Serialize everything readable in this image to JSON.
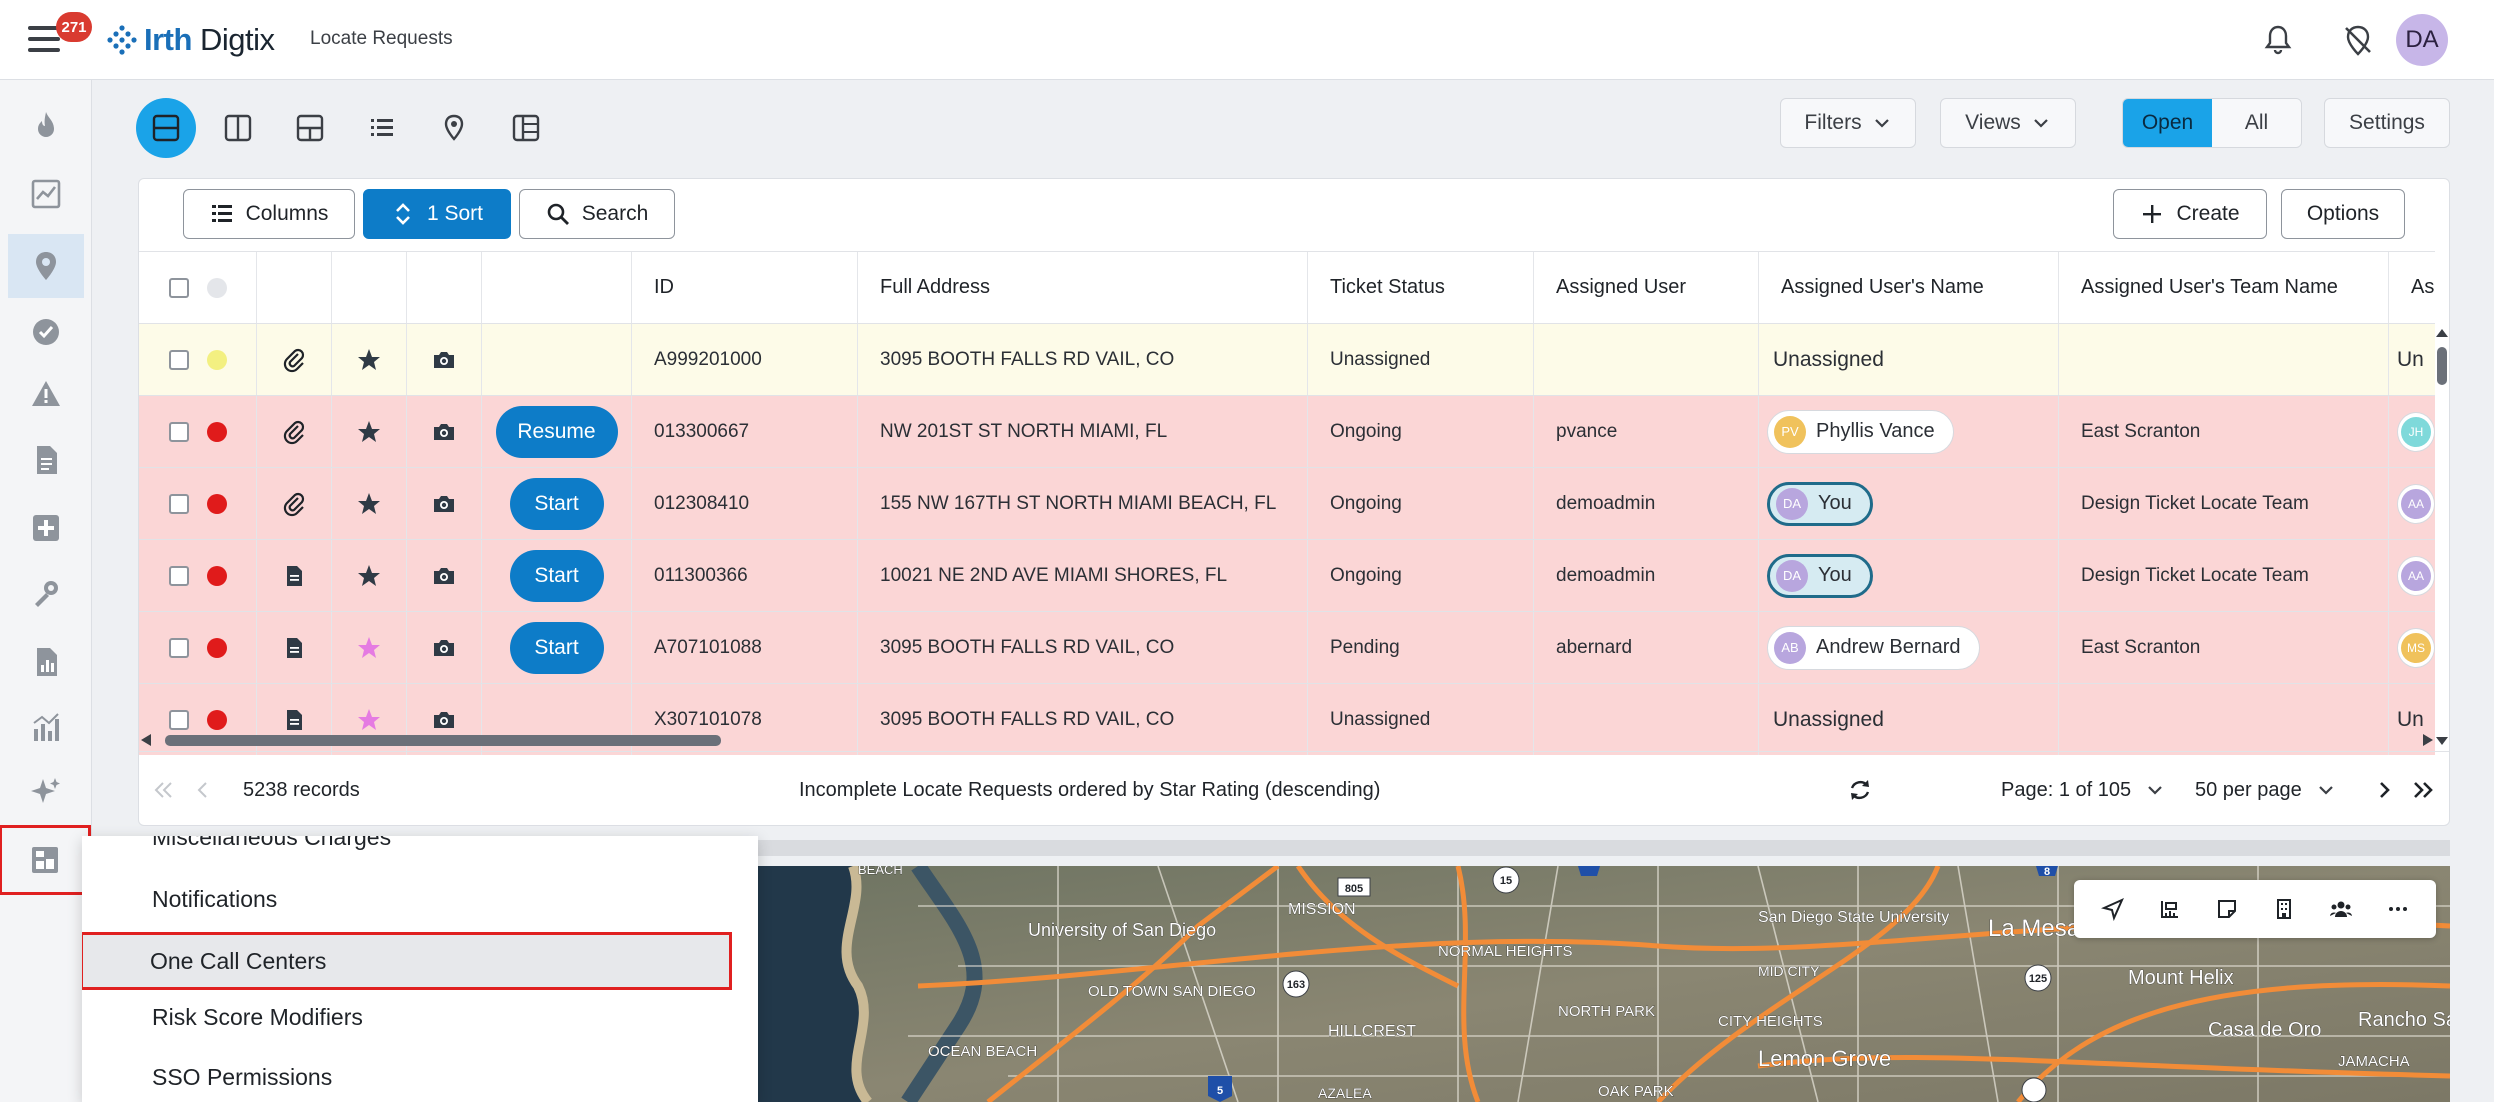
{
  "header": {
    "notification_count": "271",
    "brand_primary": "Irth",
    "brand_secondary": "Digtix",
    "page_title": "Locate Requests",
    "user_initials": "DA"
  },
  "view_toolbar": {
    "filters_label": "Filters",
    "views_label": "Views",
    "open_label": "Open",
    "all_label": "All",
    "settings_label": "Settings"
  },
  "grid_toolbar": {
    "columns_label": "Columns",
    "sort_label": "1 Sort",
    "search_label": "Search",
    "create_label": "Create",
    "options_label": "Options"
  },
  "table": {
    "columns": [
      "ID",
      "Full Address",
      "Ticket Status",
      "Assigned User",
      "Assigned User's Name",
      "Assigned User's Team Name",
      "As"
    ],
    "rows": [
      {
        "id": "A999201000",
        "address": "3095 BOOTH FALLS RD VAIL, CO",
        "status": "Unassigned",
        "user": "",
        "name": "Unassigned",
        "initials": "",
        "team": "",
        "partial": "Un",
        "dot": "#f3f081",
        "doc": "paperclip-icon",
        "star": "#2f3a45",
        "action": "",
        "bg": "#fdfbe8"
      },
      {
        "id": "013300667",
        "address": "NW 201ST ST NORTH MIAMI, FL",
        "status": "Ongoing",
        "user": "pvance",
        "name": "Phyllis Vance",
        "initials": "PV",
        "team": "East Scranton",
        "partial": "JH",
        "dot": "#e01b1b",
        "doc": "paperclip-icon",
        "star": "#2f3a45",
        "action": "Resume",
        "bg": "#fbd6d6"
      },
      {
        "id": "012308410",
        "address": "155 NW 167TH ST NORTH MIAMI BEACH, FL",
        "status": "Ongoing",
        "user": "demoadmin",
        "name": "You",
        "initials": "DA",
        "team": "Design Ticket Locate Team",
        "partial": "AA",
        "dot": "#e01b1b",
        "doc": "paperclip-icon",
        "star": "#2f3a45",
        "action": "Start",
        "bg": "#fbd6d6"
      },
      {
        "id": "011300366",
        "address": "10021 NE 2ND AVE MIAMI SHORES, FL",
        "status": "Ongoing",
        "user": "demoadmin",
        "name": "You",
        "initials": "DA",
        "team": "Design Ticket Locate Team",
        "partial": "AA",
        "dot": "#e01b1b",
        "doc": "document-icon",
        "star": "#2f3a45",
        "action": "Start",
        "bg": "#fbd6d6"
      },
      {
        "id": "A707101088",
        "address": "3095 BOOTH FALLS RD VAIL, CO",
        "status": "Pending",
        "user": "abernard",
        "name": "Andrew Bernard",
        "initials": "AB",
        "team": "East Scranton",
        "partial": "MS",
        "dot": "#e01b1b",
        "doc": "document-icon",
        "star": "#e57be2",
        "action": "Start",
        "bg": "#fbd6d6"
      },
      {
        "id": "X307101078",
        "address": "3095 BOOTH FALLS RD VAIL, CO",
        "status": "Unassigned",
        "user": "",
        "name": "Unassigned",
        "initials": "",
        "team": "",
        "partial": "Un",
        "dot": "#e01b1b",
        "doc": "document-icon",
        "star": "#e57be2",
        "action": "",
        "bg": "#fbd6d6"
      }
    ]
  },
  "footer": {
    "records": "5238 records",
    "description": "Incomplete Locate Requests ordered by Star Rating (descending)",
    "page": "Page: 1 of 105",
    "per_page": "50 per page"
  },
  "menu": {
    "items": [
      "Miscellaneous Charges",
      "Notifications",
      "One Call Centers",
      "Risk Score Modifiers",
      "SSO Permissions"
    ]
  },
  "map": {
    "labels": [
      "University of San Diego",
      "MISSION",
      "San Diego State University",
      "La Mesa",
      "NORMAL HEIGHTS",
      "OLD TOWN SAN DIEGO",
      "MID CITY",
      "Mount Helix",
      "HILLCREST",
      "NORTH PARK",
      "CITY HEIGHTS",
      "Casa de Oro",
      "Rancho San Diego",
      "OCEAN BEACH",
      "Lemon Grove",
      "JAMACHA",
      "OAK PARK",
      "AZALEA",
      "BEACH"
    ],
    "shields": [
      "15",
      "805",
      "8",
      "163",
      "125",
      "5"
    ]
  }
}
